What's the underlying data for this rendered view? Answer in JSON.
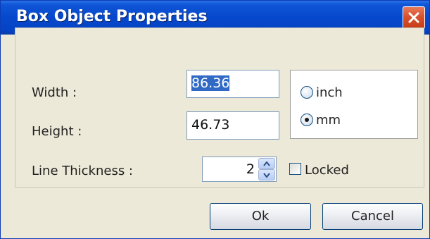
{
  "dialog": {
    "title": "Box Object Properties"
  },
  "fields": {
    "width_label": "Width :",
    "width_value": "86.36",
    "height_label": "Height :",
    "height_value": "46.73",
    "line_thickness_label": "Line Thickness :",
    "line_thickness_value": "2"
  },
  "units": {
    "options": [
      {
        "label": "inch",
        "selected": false
      },
      {
        "label": "mm",
        "selected": true
      }
    ]
  },
  "locked": {
    "label": "Locked",
    "checked": false
  },
  "buttons": {
    "ok_label": "Ok",
    "cancel_label": "Cancel"
  },
  "icons": {
    "close": "close-icon",
    "spin_up": "chevron-up-icon",
    "spin_down": "chevron-down-icon"
  },
  "colors": {
    "titlebar": "#0648cc",
    "close_button": "#d9522e",
    "dialog_background": "#ece9d8",
    "selection": "#316ac5"
  }
}
